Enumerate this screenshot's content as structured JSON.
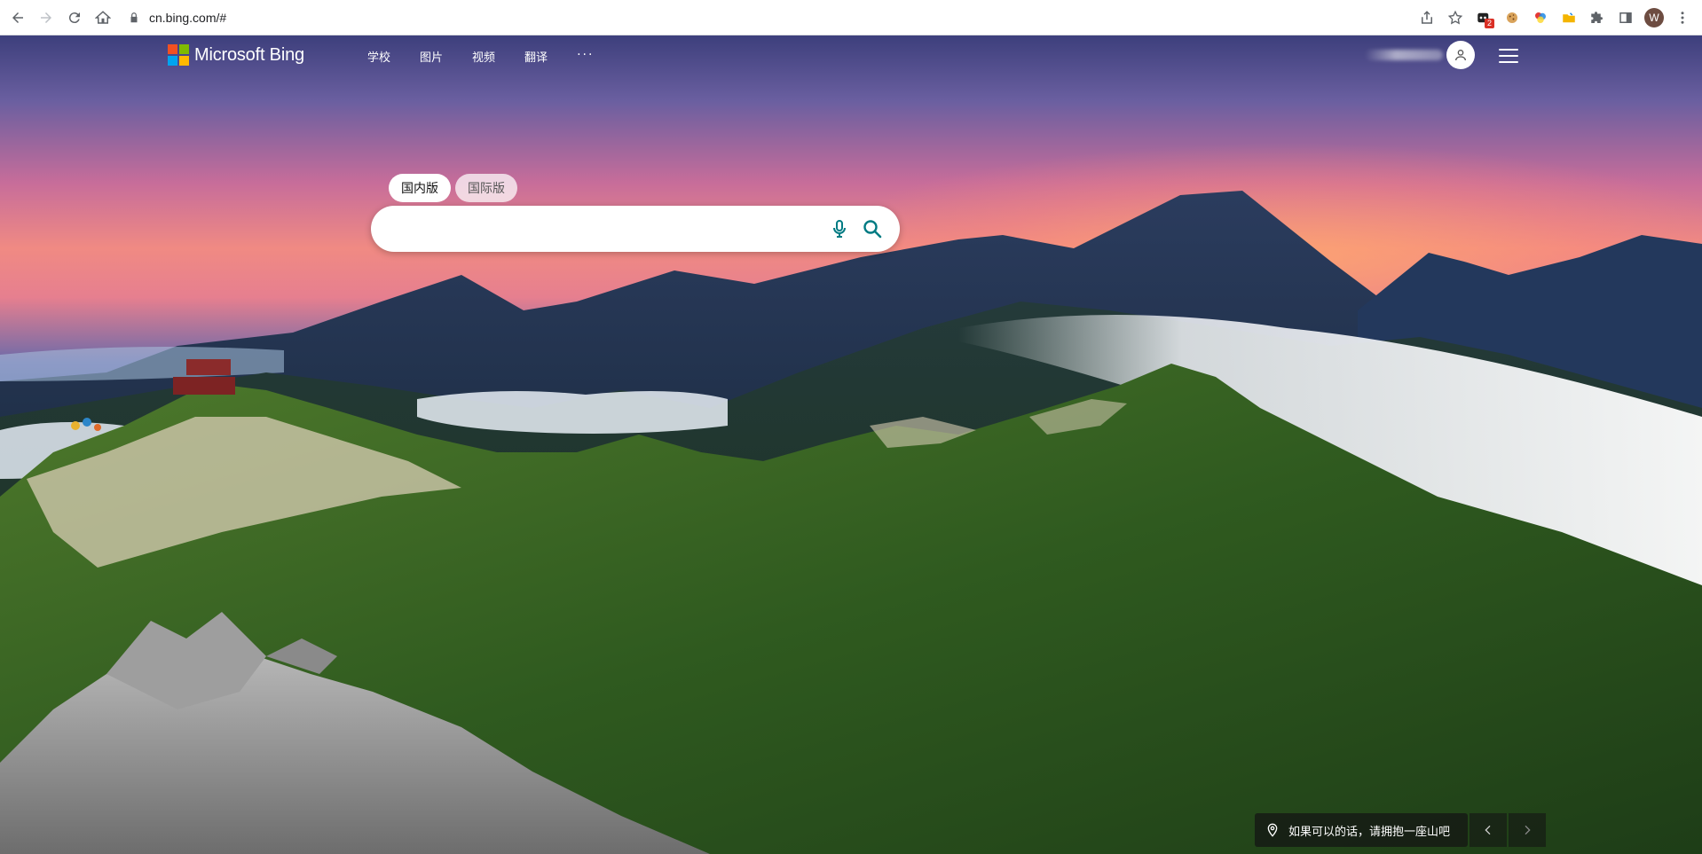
{
  "browser": {
    "url": "cn.bing.com/#",
    "profile_initial": "W",
    "extension_badge": "2"
  },
  "header": {
    "logo_text": "Microsoft Bing",
    "nav": [
      "学校",
      "图片",
      "视频",
      "翻译",
      "···"
    ]
  },
  "search": {
    "tabs": [
      "国内版",
      "国际版"
    ],
    "active_tab": "国内版",
    "placeholder": ""
  },
  "footer": {
    "image_caption": "如果可以的话，请拥抱一座山吧"
  },
  "colors": {
    "accent_teal": "#007b83",
    "ms_red": "#f25022",
    "ms_green": "#7fba00",
    "ms_blue": "#00a4ef",
    "ms_yellow": "#ffb900"
  }
}
